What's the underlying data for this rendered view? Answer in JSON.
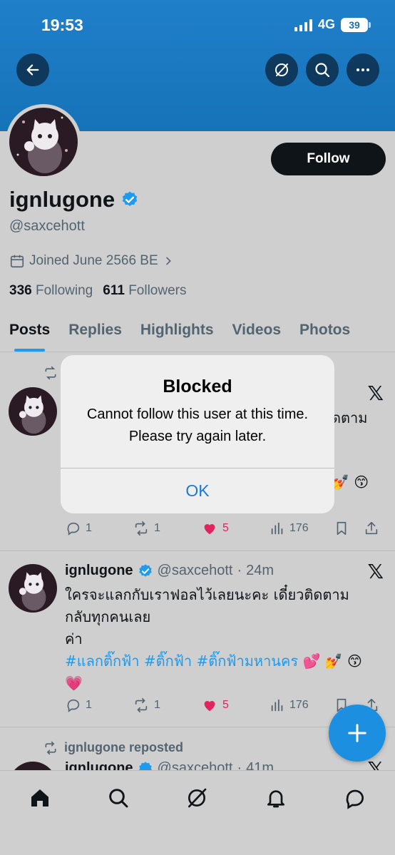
{
  "status_bar": {
    "time": "19:53",
    "network": "4G",
    "battery": "39"
  },
  "profile": {
    "follow_label": "Follow",
    "display_name": "ignlugone",
    "handle": "@saxcehott",
    "joined": "Joined June 2566 BE",
    "following_count": "336",
    "following_label": "Following",
    "followers_count": "611",
    "followers_label": "Followers"
  },
  "tabs": [
    "Posts",
    "Replies",
    "Highlights",
    "Videos",
    "Photos"
  ],
  "tweets": [
    {
      "reposted_by": "",
      "text_tail": "ดตาม",
      "emojis": "💅 😙",
      "replies": "1",
      "reposts": "1",
      "likes": "5",
      "views": "176"
    },
    {
      "name": "ignlugone",
      "handle": "@saxcehott",
      "dot": "·",
      "time": "24m",
      "line1": "ใครจะแลกกับเราฟอลไว้เลยนะคะ เดี๋ยวติดตาม",
      "line2": "กลับทุกคนเลย",
      "line3": "ค่า",
      "hashtags": "#แลกติ๊กฟ้า #ติ๊กฟ้า #ติ๊กฟ้ามหานคร",
      "emojis_a": "💕 💅 😙",
      "emojis_b": "💗",
      "replies": "1",
      "reposts": "1",
      "likes": "5",
      "views": "176"
    },
    {
      "reposted_by": "ignlugone reposted",
      "name": "ignlugone",
      "handle": "@saxcehott",
      "dot": "·",
      "time": "41m"
    }
  ],
  "dialog": {
    "title": "Blocked",
    "message": "Cannot follow this user at this time. Please try again later.",
    "ok_label": "OK"
  },
  "colors": {
    "banner": "#1673b8",
    "accent": "#1d9bf0",
    "like": "#e0245e",
    "background": "#cfcfcf"
  }
}
